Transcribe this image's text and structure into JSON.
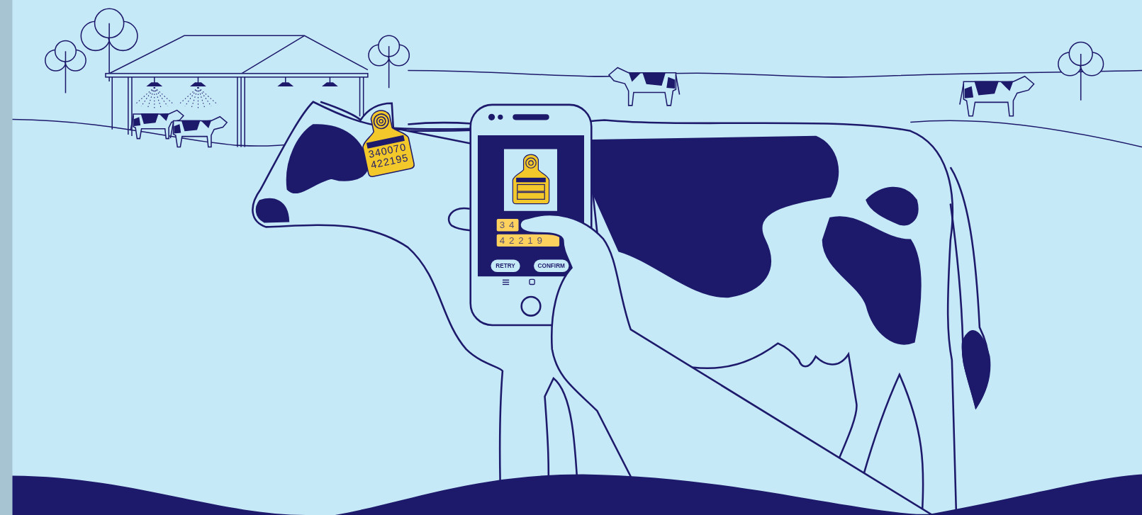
{
  "ear_tag": {
    "lines": [
      "340070",
      "422195"
    ]
  },
  "phone": {
    "fields": [
      {
        "value": "3 4"
      },
      {
        "value": "4 2 2 1 9"
      }
    ],
    "buttons": [
      {
        "label": "RETRY"
      },
      {
        "label": "CONFIRM"
      }
    ]
  }
}
